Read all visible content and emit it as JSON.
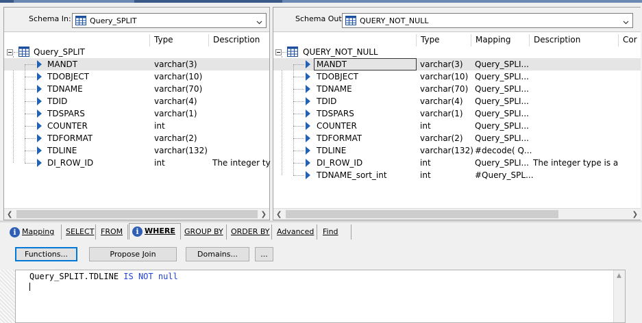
{
  "schema_in": {
    "label": "Schema In:",
    "selected": "Query_SPLIT",
    "columns": [
      "Type",
      "Description"
    ],
    "root": "Query_SPLIT",
    "rows": [
      {
        "name": "MANDT",
        "type": "varchar(3)",
        "description": ""
      },
      {
        "name": "TDOBJECT",
        "type": "varchar(10)",
        "description": ""
      },
      {
        "name": "TDNAME",
        "type": "varchar(70)",
        "description": ""
      },
      {
        "name": "TDID",
        "type": "varchar(4)",
        "description": ""
      },
      {
        "name": "TDSPARS",
        "type": "varchar(1)",
        "description": ""
      },
      {
        "name": "COUNTER",
        "type": "int",
        "description": ""
      },
      {
        "name": "TDFORMAT",
        "type": "varchar(2)",
        "description": ""
      },
      {
        "name": "TDLINE",
        "type": "varchar(132)",
        "description": ""
      },
      {
        "name": "DI_ROW_ID",
        "type": "int",
        "description": "The integer type"
      }
    ]
  },
  "schema_out": {
    "label": "Schema Out:",
    "selected": "QUERY_NOT_NULL",
    "columns": [
      "Type",
      "Mapping",
      "Description",
      "Cor"
    ],
    "root": "QUERY_NOT_NULL",
    "rows": [
      {
        "name": "MANDT",
        "type": "varchar(3)",
        "mapping": "Query_SPLI...",
        "description": ""
      },
      {
        "name": "TDOBJECT",
        "type": "varchar(10)",
        "mapping": "Query_SPLI...",
        "description": ""
      },
      {
        "name": "TDNAME",
        "type": "varchar(70)",
        "mapping": "Query_SPLI...",
        "description": ""
      },
      {
        "name": "TDID",
        "type": "varchar(4)",
        "mapping": "Query_SPLI...",
        "description": ""
      },
      {
        "name": "TDSPARS",
        "type": "varchar(1)",
        "mapping": "Query_SPLI...",
        "description": ""
      },
      {
        "name": "COUNTER",
        "type": "int",
        "mapping": "Query_SPLI...",
        "description": ""
      },
      {
        "name": "TDFORMAT",
        "type": "varchar(2)",
        "mapping": "Query_SPLI...",
        "description": ""
      },
      {
        "name": "TDLINE",
        "type": "varchar(132)",
        "mapping": "#decode( Q...",
        "description": ""
      },
      {
        "name": "DI_ROW_ID",
        "type": "int",
        "mapping": "Query_SPLI...",
        "description": "The integer type is a..."
      },
      {
        "name": "TDNAME_sort_int",
        "type": "int",
        "mapping": "#Query_SPL...",
        "description": ""
      }
    ]
  },
  "tabs": {
    "mapping": "Mapping",
    "select": "SELECT",
    "from": "FROM",
    "where": "WHERE",
    "group_by": "GROUP BY",
    "order_by": "ORDER BY",
    "advanced": "Advanced",
    "find": "Find",
    "active": "WHERE"
  },
  "buttons": {
    "functions": "Functions...",
    "propose_join": "Propose Join",
    "domains": "Domains...",
    "more": "..."
  },
  "editor": {
    "prefix": "Query_SPLIT.TDLINE ",
    "keywords": "IS NOT null"
  },
  "colors": {
    "accent_blue": "#2262b5",
    "keyword_blue": "#1f3fd8",
    "selection_gray": "#e5e5e5"
  },
  "icons": [
    "table-icon",
    "tree-collapse-icon",
    "column-arrow-icon",
    "info-icon",
    "chevron-down-icon",
    "scroll-left-icon",
    "scroll-right-icon",
    "scroll-up-icon"
  ]
}
